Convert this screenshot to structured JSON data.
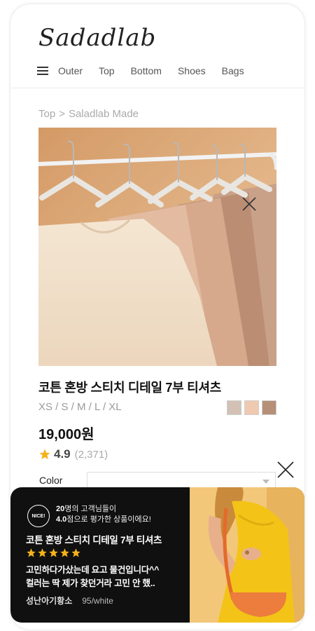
{
  "app": {
    "logo": "Sadadlab"
  },
  "nav": {
    "items": [
      "Outer",
      "Top",
      "Bottom",
      "Shoes",
      "Bags"
    ]
  },
  "breadcrumb": {
    "parts": [
      "Top",
      ">",
      "Saladlab Made"
    ]
  },
  "product": {
    "title": "코튼 혼방 스티치 디테일 7부 티셔츠",
    "sizes": "XS / S / M / L / XL",
    "swatches": [
      "#d3c1b5",
      "#f0c9b1",
      "#b68f78"
    ],
    "price": "19,000원",
    "rating": "4.9",
    "review_count": "(2,371)",
    "image_icon": "close-icon"
  },
  "option": {
    "label": "Color",
    "selected": ""
  },
  "review_popup": {
    "badge": "NICE!",
    "summary_line1_count": "20",
    "summary_line1_rest": "명의 고객님들이",
    "summary_line2_score": "4.0",
    "summary_line2_rest": "점으로 평가한 상품이에요!",
    "product_title": "코튼 혼방 스티치 디테일 7부 티셔츠",
    "stars": 5,
    "text_line1": "고민하다가샀는데 요고 물건입니다^^",
    "text_line2": "컬러는 딱 제가 찾던거라 고민 안 했..",
    "reviewer": "성난아기황소",
    "spec": "95/white",
    "close_icon": "close-icon"
  },
  "colors": {
    "star": "#f4b21b",
    "card_bg": "#101010",
    "text_muted": "#aaaaaa"
  }
}
